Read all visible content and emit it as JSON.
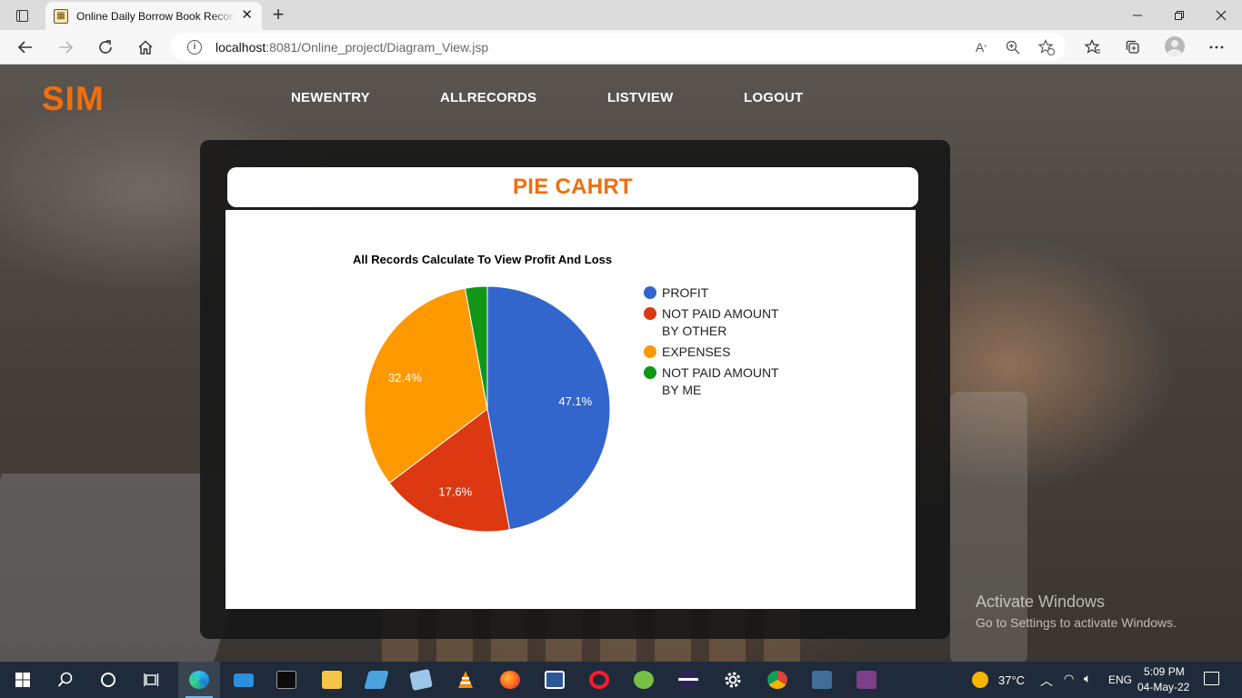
{
  "browser": {
    "tab_title": "Online Daily Borrow Book Records",
    "tab_close": "✕",
    "new_tab": "+",
    "url_host": "localhost",
    "url_rest": ":8081/Online_project/Diagram_View.jsp"
  },
  "site": {
    "brand": "SIM",
    "nav": [
      "NEWENTRY",
      "ALLRECORDS",
      "LISTVIEW",
      "LOGOUT"
    ],
    "panel_title": "PIE CAHRT"
  },
  "chart_data": {
    "type": "pie",
    "title": "All Records Calculate To View Profit And Loss",
    "slices": [
      {
        "label": "PROFIT",
        "legend_lines": [
          "PROFIT"
        ],
        "percent": 47.1,
        "display": "47.1%",
        "color": "#3366cc"
      },
      {
        "label": "NOT PAID AMOUNT BY OTHER",
        "legend_lines": [
          "NOT PAID AMOUNT",
          "BY OTHER"
        ],
        "percent": 17.6,
        "display": "17.6%",
        "color": "#dc3912"
      },
      {
        "label": "EXPENSES",
        "legend_lines": [
          "EXPENSES"
        ],
        "percent": 32.4,
        "display": "32.4%",
        "color": "#ff9900"
      },
      {
        "label": "NOT PAID AMOUNT BY ME",
        "legend_lines": [
          "NOT PAID AMOUNT",
          "BY ME"
        ],
        "percent": 2.9,
        "display": "",
        "color": "#109618"
      }
    ],
    "legend_position": "right"
  },
  "watermark": {
    "line1": "Activate Windows",
    "line2": "Go to Settings to activate Windows."
  },
  "taskbar": {
    "temperature": "37°C",
    "language": "ENG",
    "time": "5:09 PM",
    "date": "04-May-22",
    "apps": [
      "start",
      "search",
      "task-view",
      "task-view-2",
      "edge",
      "mail",
      "terminal",
      "file-explorer",
      "remote-desktop",
      "notes",
      "vlc",
      "firefox",
      "word",
      "opera",
      "torrent",
      "eclipse",
      "settings",
      "chrome",
      "mysql-workbench",
      "game"
    ]
  }
}
